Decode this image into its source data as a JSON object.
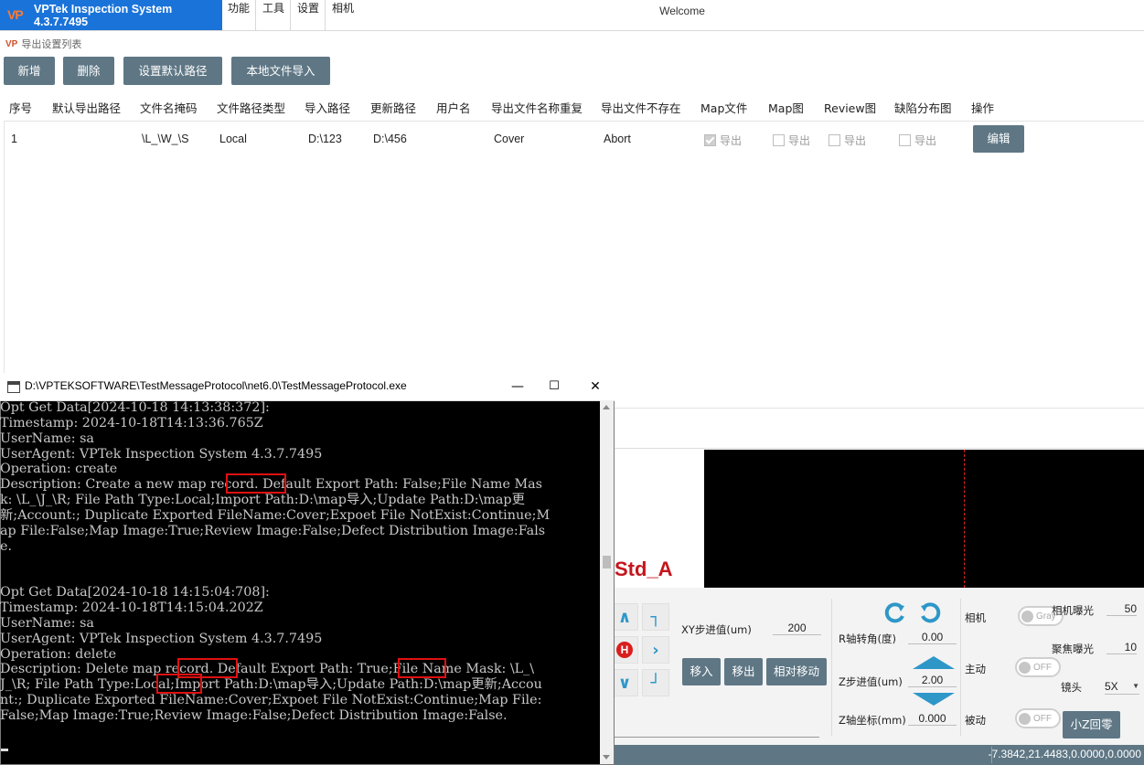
{
  "app": {
    "title": "VPTek Inspection System 4.3.7.7495",
    "logo": "VP",
    "welcome": "Welcome"
  },
  "menu": [
    "功能",
    "工具",
    "设置",
    "相机"
  ],
  "page": {
    "breadcrumb": "导出设置列表"
  },
  "toolbar": {
    "add": "新增",
    "delete": "删除",
    "set_default": "设置默认路径",
    "local_import": "本地文件导入"
  },
  "table": {
    "columns": [
      "序号",
      "默认导出路径",
      "文件名掩码",
      "文件路径类型",
      "导入路径",
      "更新路径",
      "用户名",
      "导出文件名称重复",
      "导出文件不存在",
      "Map文件",
      "Map图",
      "Review图",
      "缺陷分布图",
      "操作"
    ],
    "rows": [
      {
        "index": "1",
        "default_path": "",
        "mask": "\\L_\\W_\\S",
        "path_type": "Local",
        "import_path": "D:\\123",
        "update_path": "D:\\456",
        "username": "",
        "dup": "Cover",
        "not_exist": "Abort",
        "map_file": {
          "label": "导出",
          "checked": true
        },
        "map_image": {
          "label": "导出",
          "checked": false
        },
        "review_image": {
          "label": "导出",
          "checked": false
        },
        "defect_map": {
          "label": "导出",
          "checked": false
        },
        "action": "编辑"
      }
    ]
  },
  "console": {
    "title": "D:\\VPTEKSOFTWARE\\TestMessageProtocol\\net6.0\\TestMessageProtocol.exe",
    "lines": [
      "Opt Get Data[2024-10-18 14:13:38:372]:",
      "Timestamp: 2024-10-18T14:13:36.765Z",
      "UserName: sa",
      "UserAgent: VPTek Inspection System 4.3.7.7495",
      "Operation: create",
      "Description: Create a new map record. Default Export Path: False;File Name Mas",
      "k: \\L_\\J_\\R; File Path Type:Local;Import Path:D:\\map导入;Update Path:D:\\map更",
      "新;Account:; Duplicate Exported FileName:Cover;Expoet File NotExist:Continue;M",
      "ap File:False;Map Image:True;Review Image:False;Defect Distribution Image:Fals",
      "e.",
      "",
      "",
      "Opt Get Data[2024-10-18 14:15:04:708]:",
      "Timestamp: 2024-10-18T14:15:04.202Z",
      "UserName: sa",
      "UserAgent: VPTek Inspection System 4.3.7.7495",
      "Operation: delete",
      "Description: Delete map record. Default Export Path: True;File Name Mask: \\L_\\",
      "J_\\R; File Path Type:Local;Import Path:D:\\map导入;Update Path:D:\\map更新;Accou",
      "nt:; Duplicate Exported FileName:Cover;Expoet File NotExist:Continue;Map File:",
      "False;Map Image:True;Review Image:False;Defect Distribution Image:False."
    ]
  },
  "camera": {
    "label": "Std_A"
  },
  "controls": {
    "xy_step_label": "XY步进值(um)",
    "xy_step": "200",
    "move_in": "移入",
    "move_out": "移出",
    "relative_move": "相对移动",
    "r_angle_label": "R轴转角(度)",
    "r_angle": "0.00",
    "z_step_label": "Z步进值(um)",
    "z_step": "2.00",
    "z_coord_label": "Z轴坐标(mm)",
    "z_coord": "0.000",
    "camera_label": "相机",
    "camera_toggle": "Gray",
    "active_label": "主动",
    "active_toggle": "OFF",
    "passive_label": "被动",
    "passive_toggle": "OFF",
    "exposure_label": "相机曝光",
    "exposure": "50",
    "focus_exposure_label": "聚焦曝光",
    "focus_exposure": "10",
    "lens_label": "镜头",
    "lens": "5X",
    "small_z_zero": "小Z回零",
    "home_glyph": "H"
  },
  "status": {
    "coords": "-7.3842,21.4483,0.0000,0.0000"
  },
  "colors": {
    "brand": "#1a73d9",
    "button": "#5f7785",
    "highlight": "#e01010",
    "std_label": "#c4161c",
    "arrow": "#2e97c8"
  }
}
